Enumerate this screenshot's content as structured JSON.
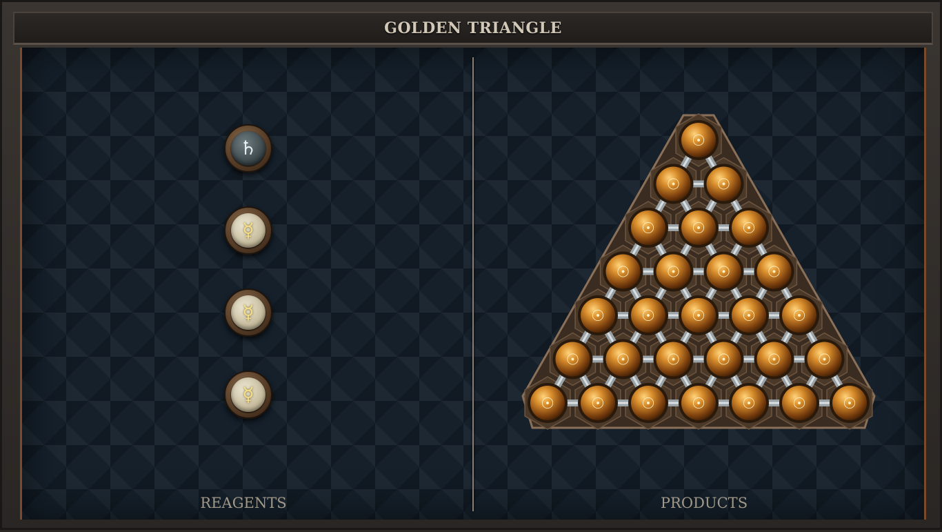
{
  "window": {
    "title": "GOLDEN TRIANGLE"
  },
  "reagents": {
    "label": "REAGENTS",
    "items": [
      {
        "element": "lead",
        "symbol": "♄",
        "icon": "saturn-lead-icon"
      },
      {
        "element": "quicksilver",
        "symbol": "☿",
        "icon": "mercury-quicksilver-icon"
      },
      {
        "element": "quicksilver",
        "symbol": "☿",
        "icon": "mercury-quicksilver-icon"
      },
      {
        "element": "quicksilver",
        "symbol": "☿",
        "icon": "mercury-quicksilver-icon"
      }
    ]
  },
  "products": {
    "label": "PRODUCTS",
    "molecule": {
      "element": "gold",
      "symbol": "☉",
      "icon": "sun-gold-icon",
      "rows": 7,
      "atom_count": 28
    }
  },
  "colors": {
    "gold_atom": "#c07a22",
    "lead_atom": "#3e4a4e",
    "quicksilver_atom": "#d8cfb3",
    "board": "#15202b"
  }
}
